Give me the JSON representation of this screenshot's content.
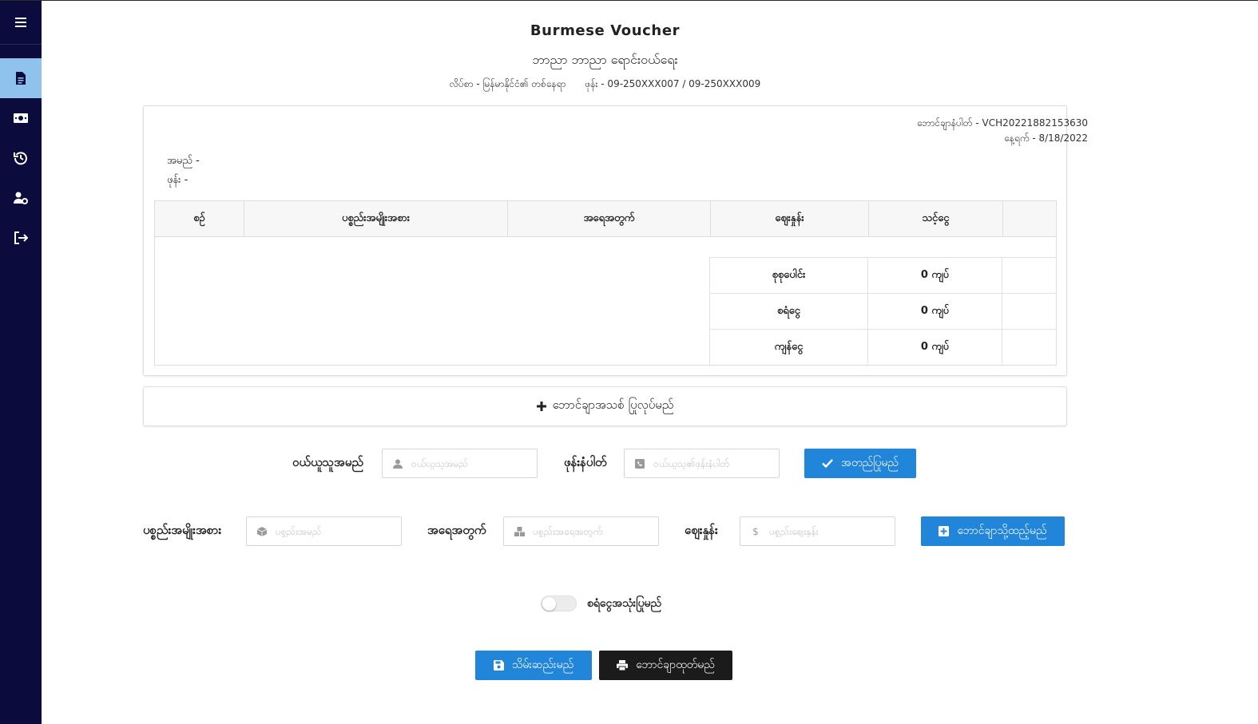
{
  "sidebar": {
    "menu_icon": "hamburger-icon",
    "items": [
      {
        "icon": "document-icon",
        "active": true
      },
      {
        "icon": "money-icon",
        "active": false
      },
      {
        "icon": "history-icon",
        "active": false
      },
      {
        "icon": "user-settings-icon",
        "active": false
      },
      {
        "icon": "logout-icon",
        "active": false
      }
    ],
    "bg_color": "#0b0c3d",
    "active_color": "#8fc3ee"
  },
  "header": {
    "title": "Burmese Voucher",
    "shop_name": "ဘာညာ ဘာညာ ရောင်းဝယ်ရေး",
    "address": "လိပ်စာ - မြန်မာနိုင်ငံ၏ တစ်နေရာ",
    "phone": "ဖုန်း - 09-250XXX007 / 09-250XXX009"
  },
  "voucher": {
    "number": "ဘောင်ချာနံပါတ် - VCH20221882153630",
    "date": "နေ့ရက် - 8/18/2022",
    "customer_name": "အမည် -",
    "customer_phone": "ဖုန်း -",
    "columns": [
      "စဉ်",
      "ပစ္စည်းအမျိုးအစား",
      "အရေအတွက်",
      "ဈေးနှုန်း",
      "သင့်ငွေ",
      ""
    ],
    "summary": [
      {
        "label": "စုစုပေါင်း",
        "value": "0 ကျပ်"
      },
      {
        "label": "စရံငွေ",
        "value": "0 ကျပ်"
      },
      {
        "label": "ကျန်ငွေ",
        "value": "0 ကျပ်"
      }
    ]
  },
  "add_voucher": {
    "label": "ဘောင်ချာအသစ် ပြုလုပ်မည်",
    "icon": "plus-icon"
  },
  "customer_form": {
    "name_label": "ဝယ်ယူသူအမည်",
    "name_placeholder": "ဝယ်ယူသူအမည်",
    "name_value": "",
    "phone_label": "ဖုန်းနံပါတ်",
    "phone_placeholder": "ဝယ်ယူသူ၏ဖုန်းနံပါတ်",
    "phone_value": "",
    "confirm_button": "အတည်ပြုမည်"
  },
  "item_form": {
    "type_label": "ပစ္စည်းအမျိုးအစား",
    "type_placeholder": "ပစ္စည်းအမည်",
    "qty_label": "အရေအတွက်",
    "qty_placeholder": "ပစ္စည်းအရေအတွက်",
    "price_label": "ဈေးနှုန်း",
    "price_placeholder": "ပစ္စည်းဈေးနှုန်း",
    "add_button": "ဘောင်ချာသို့ထည့်မည်"
  },
  "deposit_toggle": {
    "label": "စရံငွေအသုံးပြုမည်",
    "on": false
  },
  "actions": {
    "save_button": "သိမ်းဆည်းမည်",
    "print_button": "ဘောင်ချာထုတ်မည်"
  },
  "colors": {
    "primary": "#2185d9",
    "dark": "#1b1b1b"
  }
}
